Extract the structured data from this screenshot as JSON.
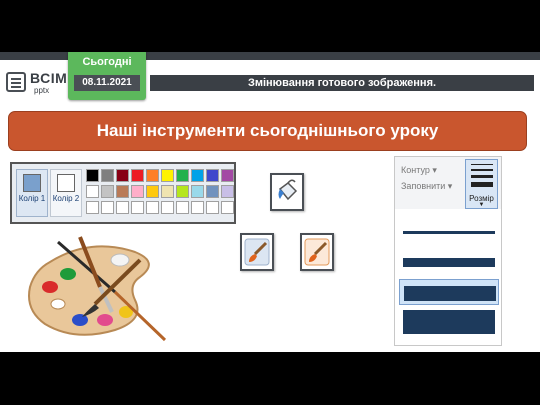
{
  "header": {
    "logo_text": "ВСІМ",
    "logo_sub": "pptx",
    "today_label": "Сьогодні",
    "date": "08.11.2021",
    "title": "Змінювання готового зображення."
  },
  "banner": {
    "text": "Наші інструменти сьогоднішнього уроку"
  },
  "palette": {
    "color1_label": "Колір 1",
    "color2_label": "Колір 2",
    "color1_value": "#7aa0cc",
    "color2_value": "#ffffff",
    "swatch_rows": [
      [
        "#000000",
        "#7f7f7f",
        "#880015",
        "#ed1c24",
        "#ff7f27",
        "#fff200",
        "#22b14c",
        "#00a2e8",
        "#3f48cc",
        "#a349a4"
      ],
      [
        "#ffffff",
        "#c3c3c3",
        "#b97a57",
        "#ffaec9",
        "#ffc90e",
        "#efe4b0",
        "#b5e61d",
        "#99d9ea",
        "#7092be",
        "#c8bfe7"
      ],
      [
        "#ffffff",
        "#ffffff",
        "#ffffff",
        "#ffffff",
        "#ffffff",
        "#ffffff",
        "#ffffff",
        "#ffffff",
        "#ffffff",
        "#ffffff"
      ]
    ]
  },
  "tools": [
    {
      "name": "fill-bucket-icon"
    },
    {
      "name": "brush-tool-icon"
    },
    {
      "name": "brush-tool-selected-icon"
    }
  ],
  "size_panel": {
    "outline_label": "Контур",
    "fill_label": "Заповнити",
    "size_label": "Розмір",
    "options": [
      {
        "thickness": 1
      },
      {
        "thickness": 3
      },
      {
        "thickness": 5
      },
      {
        "thickness": 8
      }
    ],
    "selected_index": 2
  },
  "colors": {
    "accent": "#c9562e",
    "header_dark": "#3a3f45",
    "today_green": "#5cb85c"
  }
}
